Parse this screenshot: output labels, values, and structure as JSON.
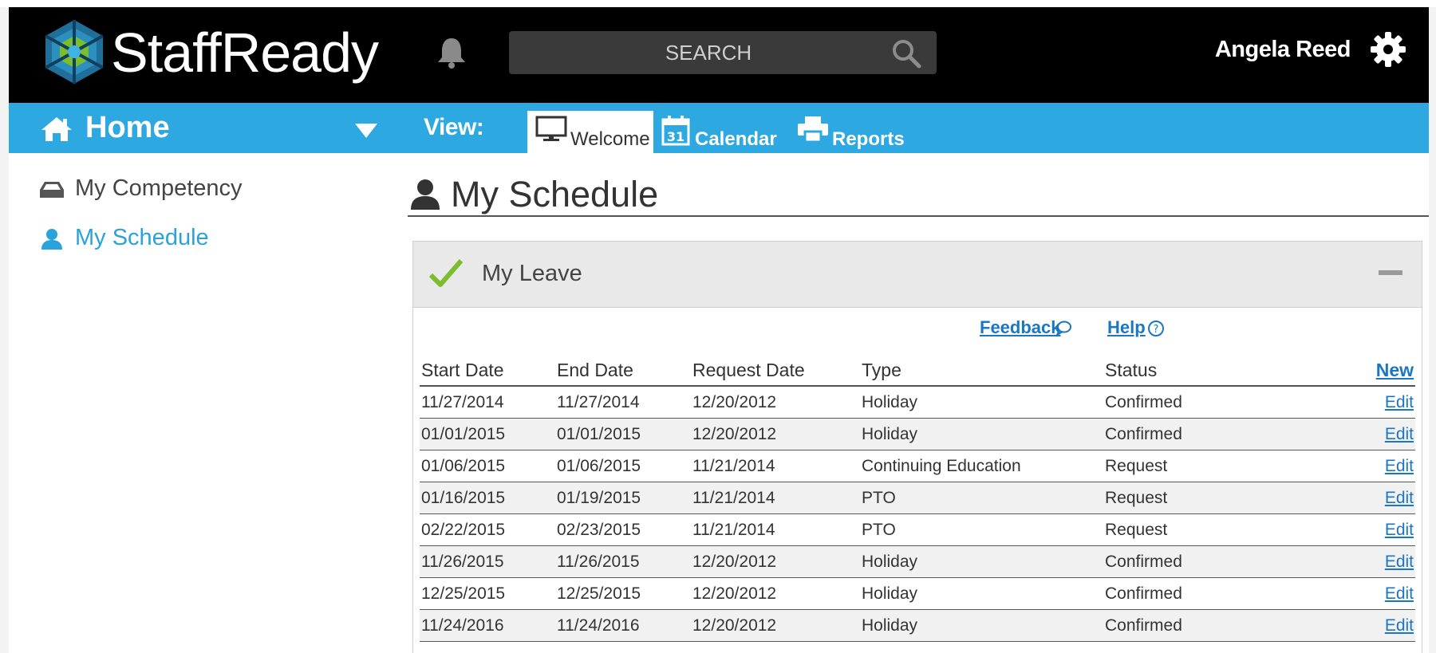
{
  "header": {
    "brand": "StaffReady",
    "search_placeholder": "SEARCH",
    "user_name": "Angela Reed"
  },
  "nav": {
    "home_label": "Home",
    "view_label": "View:",
    "tabs": [
      {
        "label": "Welcome",
        "active": true,
        "icon": "monitor-icon"
      },
      {
        "label": "Calendar",
        "active": false,
        "icon": "calendar-icon"
      },
      {
        "label": "Reports",
        "active": false,
        "icon": "printer-icon"
      }
    ]
  },
  "sidebar": {
    "items": [
      {
        "label": "My Competency",
        "icon": "inbox-tray-icon",
        "active": false
      },
      {
        "label": "My Schedule",
        "icon": "user-icon",
        "active": true
      }
    ]
  },
  "main": {
    "page_title": "My Schedule",
    "panel": {
      "title": "My Leave",
      "feedback_label": "Feedback",
      "help_label": "Help",
      "columns": [
        "Start Date",
        "End Date",
        "Request Date",
        "Type",
        "Status"
      ],
      "new_label": "New",
      "edit_label": "Edit",
      "rows": [
        {
          "start": "11/27/2014",
          "end": "11/27/2014",
          "request": "12/20/2012",
          "type": "Holiday",
          "status": "Confirmed"
        },
        {
          "start": "01/01/2015",
          "end": "01/01/2015",
          "request": "12/20/2012",
          "type": "Holiday",
          "status": "Confirmed"
        },
        {
          "start": "01/06/2015",
          "end": "01/06/2015",
          "request": "11/21/2014",
          "type": "Continuing Education",
          "status": "Request"
        },
        {
          "start": "01/16/2015",
          "end": "01/19/2015",
          "request": "11/21/2014",
          "type": "PTO",
          "status": "Request"
        },
        {
          "start": "02/22/2015",
          "end": "02/23/2015",
          "request": "11/21/2014",
          "type": "PTO",
          "status": "Request"
        },
        {
          "start": "11/26/2015",
          "end": "11/26/2015",
          "request": "12/20/2012",
          "type": "Holiday",
          "status": "Confirmed"
        },
        {
          "start": "12/25/2015",
          "end": "12/25/2015",
          "request": "12/20/2012",
          "type": "Holiday",
          "status": "Confirmed"
        },
        {
          "start": "11/24/2016",
          "end": "11/24/2016",
          "request": "12/20/2012",
          "type": "Holiday",
          "status": "Confirmed"
        }
      ]
    }
  },
  "colors": {
    "topbar": "#000000",
    "navbar": "#2ea8e0",
    "link": "#1b76c4",
    "active_sidebar": "#2aa2dc",
    "check": "#7cbd2e"
  }
}
